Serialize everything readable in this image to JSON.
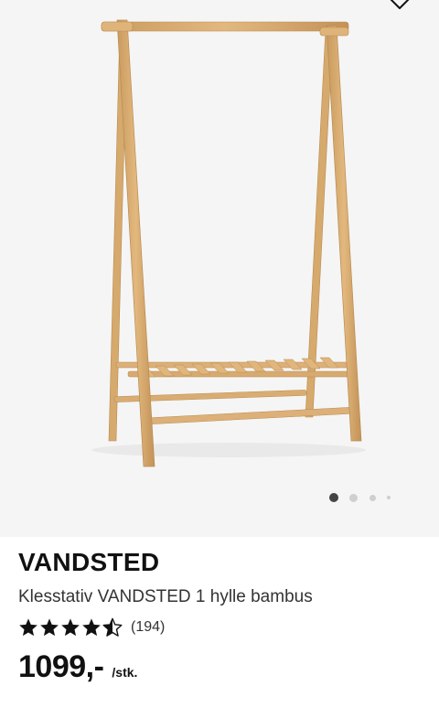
{
  "gallery": {
    "image_subject": "bamboo clothes rack with one shelf",
    "wishlist_icon": "heart-icon",
    "dots_total": 4,
    "active_dot_index": 0
  },
  "product": {
    "name": "VANDSTED",
    "description": "Klesstativ VANDSTED 1 hylle bambus",
    "rating": 4.5,
    "rating_max": 5,
    "review_count": "(194)",
    "price": "1099,-",
    "price_unit": "/stk."
  },
  "colors": {
    "bamboo": "#d9ad72",
    "bamboo_dark": "#b98c52",
    "image_background": "#f5f5f5",
    "star": "#111111"
  }
}
